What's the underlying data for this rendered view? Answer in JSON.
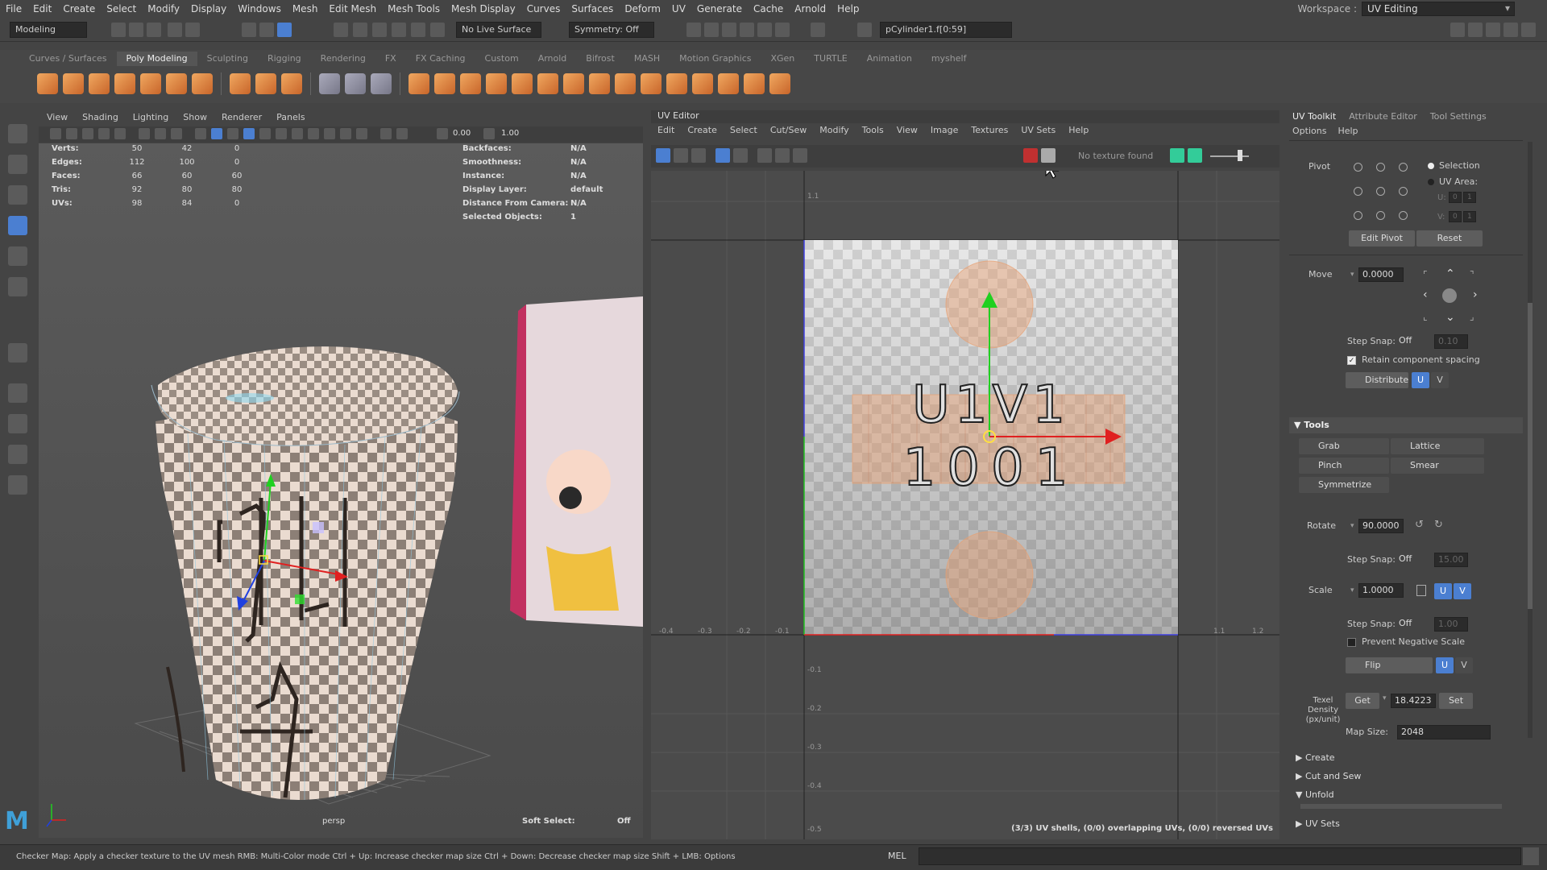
{
  "menubar": [
    "File",
    "Edit",
    "Create",
    "Select",
    "Modify",
    "Display",
    "Windows",
    "Mesh",
    "Edit Mesh",
    "Mesh Tools",
    "Mesh Display",
    "Curves",
    "Surfaces",
    "Deform",
    "UV",
    "Generate",
    "Cache",
    "Arnold",
    "Help"
  ],
  "workspace": {
    "label": "Workspace :",
    "value": "UV Editing"
  },
  "statusline": {
    "mode": "Modeling",
    "live_surface": "No Live Surface",
    "symmetry": "Symmetry: Off",
    "selection_field": "pCylinder1.f[0:59]"
  },
  "shelf_tabs": [
    "Curves / Surfaces",
    "Poly Modeling",
    "Sculpting",
    "Rigging",
    "Rendering",
    "FX",
    "FX Caching",
    "Custom",
    "Arnold",
    "Bifrost",
    "MASH",
    "Motion Graphics",
    "XGen",
    "TURTLE",
    "Animation",
    "myshelf"
  ],
  "shelf_active": "Poly Modeling",
  "viewport": {
    "menu": [
      "View",
      "Shading",
      "Lighting",
      "Show",
      "Renderer",
      "Panels"
    ],
    "toolbar_values": [
      "0.00",
      "1.00"
    ],
    "hud_left": [
      {
        "label": "Verts:",
        "a": "50",
        "b": "42",
        "c": "0"
      },
      {
        "label": "Edges:",
        "a": "112",
        "b": "100",
        "c": "0"
      },
      {
        "label": "Faces:",
        "a": "66",
        "b": "60",
        "c": "60"
      },
      {
        "label": "Tris:",
        "a": "92",
        "b": "80",
        "c": "80"
      },
      {
        "label": "UVs:",
        "a": "98",
        "b": "84",
        "c": "0"
      }
    ],
    "hud_right": [
      {
        "label": "Backfaces:",
        "value": "N/A"
      },
      {
        "label": "Smoothness:",
        "value": "N/A"
      },
      {
        "label": "Instance:",
        "value": "N/A"
      },
      {
        "label": "Display Layer:",
        "value": "default"
      },
      {
        "label": "Distance From Camera:",
        "value": "N/A"
      },
      {
        "label": "Selected Objects:",
        "value": "1"
      }
    ],
    "camera": "persp",
    "soft_select_label": "Soft Select:",
    "soft_select_value": "Off"
  },
  "uv_editor": {
    "title": "UV Editor",
    "menu": [
      "Edit",
      "Create",
      "Select",
      "Cut/Sew",
      "Modify",
      "Tools",
      "View",
      "Image",
      "Textures",
      "UV Sets",
      "Help"
    ],
    "texture_status": "No texture found",
    "tile_text_1": "U1V1",
    "tile_text_2": "1001",
    "axis_labels_x": [
      "-0.4",
      "-0.3",
      "-0.2",
      "-0.1",
      "1.1",
      "1.2"
    ],
    "axis_labels_y": [
      "1.1",
      "-0.1",
      "-0.2",
      "-0.3",
      "-0.4",
      "-0.5"
    ],
    "status": "(3/3) UV shells, (0/0) overlapping UVs, (0/0) reversed UVs"
  },
  "right_panel": {
    "tabs": [
      "UV Toolkit",
      "Attribute Editor",
      "Tool Settings"
    ],
    "submenu": [
      "Options",
      "Help"
    ],
    "pivot": {
      "label": "Pivot",
      "opt1": "Selection",
      "opt2": "UV Area:",
      "u_label": "U:",
      "v_label": "V:",
      "u_val": "0",
      "v_val": "1",
      "edit": "Edit Pivot",
      "reset": "Reset"
    },
    "move": {
      "label": "Move",
      "value": "0.0000",
      "step_label": "Step Snap:",
      "step": "Off",
      "step_val": "0.10",
      "retain": "Retain component spacing",
      "distribute": "Distribute",
      "u": "U",
      "v": "V"
    },
    "tools": {
      "header": "Tools",
      "grab": "Grab",
      "lattice": "Lattice",
      "pinch": "Pinch",
      "smear": "Smear",
      "symmetrize": "Symmetrize"
    },
    "rotate": {
      "label": "Rotate",
      "value": "90.0000",
      "step_label": "Step Snap:",
      "step": "Off",
      "step_val": "15.00"
    },
    "scale": {
      "label": "Scale",
      "value": "1.0000",
      "u": "U",
      "v": "V",
      "step_label": "Step Snap:",
      "step": "Off",
      "step_val": "1.00",
      "prevent": "Prevent Negative Scale",
      "flip": "Flip"
    },
    "texel": {
      "label1": "Texel",
      "label2": "Density",
      "label3": "(px/unit)",
      "get": "Get",
      "value": "18.4223",
      "set": "Set",
      "map_label": "Map Size:",
      "map_value": "2048"
    },
    "sections": [
      "Create",
      "Cut and Sew",
      "Unfold",
      "UV Sets"
    ]
  },
  "help_line": "Checker Map: Apply a checker texture to the UV mesh RMB: Multi-Color mode Ctrl + Up: Increase checker map size Ctrl + Down: Decrease checker map size Shift + LMB: Options",
  "mel_label": "MEL",
  "colors": {
    "accent_blue": "#4b7fd1",
    "shelf_orange": "#e08a45",
    "gizmo_red": "#e02020",
    "gizmo_green": "#20d020",
    "gizmo_blue": "#2040e0"
  }
}
